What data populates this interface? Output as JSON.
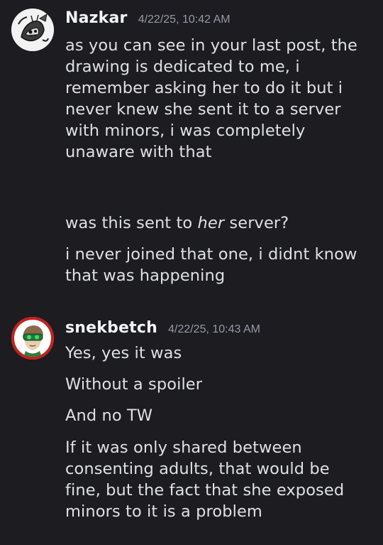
{
  "messages": [
    {
      "username": "Nazkar",
      "timestamp": "4/22/25, 10:42 AM",
      "avatar_icon": "sketch-skull-avatar-icon",
      "lines": [
        "as you can see in your last post, the",
        "drawing is dedicated to me, i",
        "remember asking her to do it but i",
        "never knew she sent it to a server",
        "with minors, i was completely",
        "unaware with that"
      ],
      "follow_up": {
        "before": "was this sent to ",
        "emphasis": "her",
        "after": " server?"
      },
      "lines2": [
        "i never joined that one, i didnt know",
        "that was happening"
      ]
    },
    {
      "username": "snekbetch",
      "timestamp": "4/22/25, 10:43 AM",
      "avatar_icon": "green-goggles-character-avatar-icon",
      "avatar_ring_color": "#c6201d",
      "lines": [
        "Yes, yes it was",
        "Without a spoiler",
        "And no TW"
      ],
      "lines2": [
        "If it was only shared between",
        "consenting adults, that would be",
        "fine, but the fact that she exposed",
        "minors to it is a problem"
      ]
    }
  ]
}
